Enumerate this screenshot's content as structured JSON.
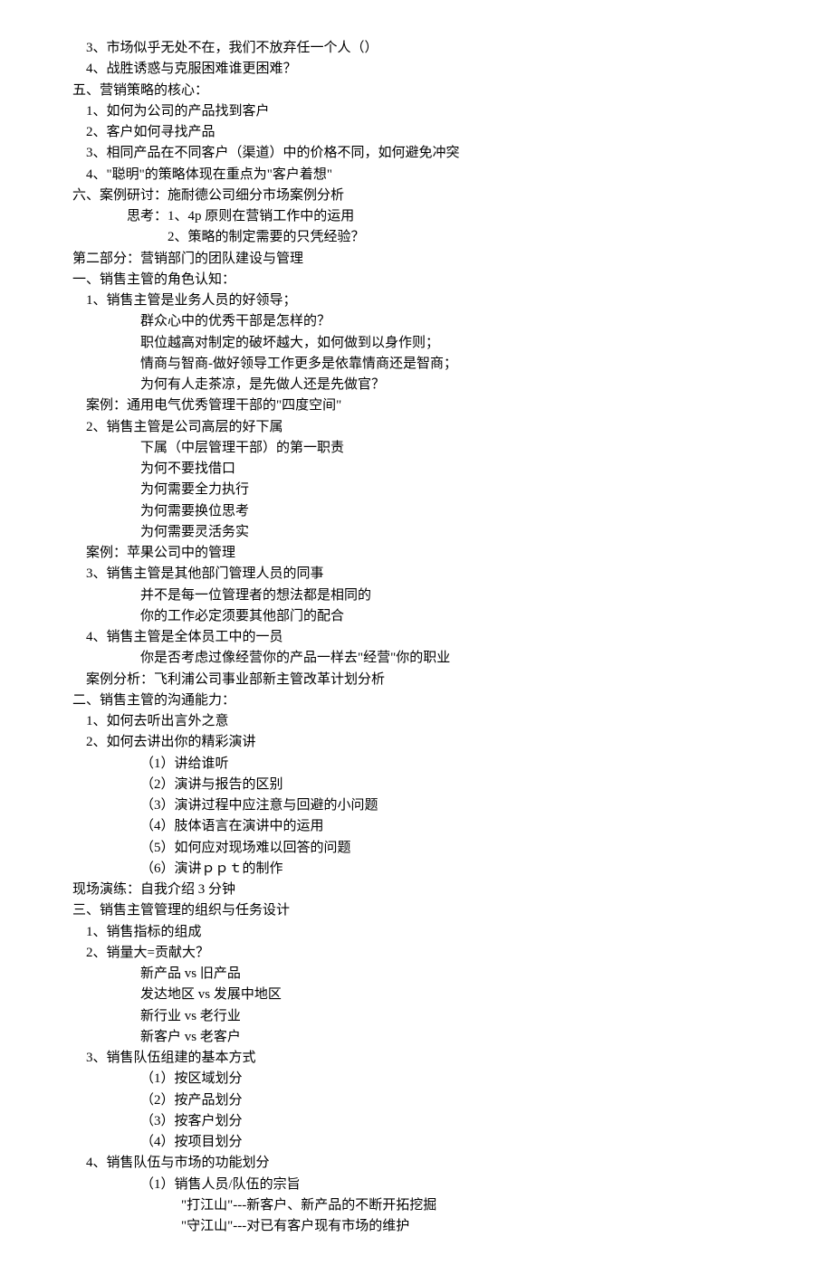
{
  "lines": [
    {
      "cls": "l1",
      "text": "3、市场似乎无处不在，我们不放弃任一个人（）"
    },
    {
      "cls": "l1",
      "text": "4、战胜诱惑与克服困难谁更困难？"
    },
    {
      "cls": "l0",
      "text": "五、营销策略的核心："
    },
    {
      "cls": "l1",
      "text": "1、如何为公司的产品找到客户"
    },
    {
      "cls": "l1",
      "text": "2、客户如何寻找产品"
    },
    {
      "cls": "l1",
      "text": "3、相同产品在不同客户（渠道）中的价格不同，如何避免冲突"
    },
    {
      "cls": "l1",
      "text": "4、\"聪明\"的策略体现在重点为\"客户着想\""
    },
    {
      "cls": "l0",
      "text": "六、案例研讨：施耐德公司细分市场案例分析"
    },
    {
      "cls": "l2",
      "text": "思考：1、4p 原则在营销工作中的运用"
    },
    {
      "cls": "l2",
      "text": "            2、策略的制定需要的只凭经验？"
    },
    {
      "cls": "l0",
      "text": "第二部分：营销部门的团队建设与管理"
    },
    {
      "cls": "l0",
      "text": "一、销售主管的角色认知："
    },
    {
      "cls": "l1",
      "text": "1、销售主管是业务人员的好领导；"
    },
    {
      "cls": "l3",
      "text": "群众心中的优秀干部是怎样的？"
    },
    {
      "cls": "l3",
      "text": "职位越高对制定的破坏越大，如何做到以身作则；"
    },
    {
      "cls": "l3",
      "text": "情商与智商-做好领导工作更多是依靠情商还是智商；"
    },
    {
      "cls": "l3",
      "text": "为何有人走茶凉，是先做人还是先做官？"
    },
    {
      "cls": "l1",
      "text": "案例：通用电气优秀管理干部的\"四度空间\""
    },
    {
      "cls": "l1",
      "text": "2、销售主管是公司高层的好下属"
    },
    {
      "cls": "l3",
      "text": "下属（中层管理干部）的第一职责"
    },
    {
      "cls": "l3",
      "text": "为何不要找借口"
    },
    {
      "cls": "l3",
      "text": "为何需要全力执行"
    },
    {
      "cls": "l3",
      "text": "为何需要换位思考"
    },
    {
      "cls": "l3",
      "text": "为何需要灵活务实"
    },
    {
      "cls": "l1",
      "text": "案例：苹果公司中的管理"
    },
    {
      "cls": "l1",
      "text": "3、销售主管是其他部门管理人员的同事"
    },
    {
      "cls": "l3",
      "text": "并不是每一位管理者的想法都是相同的"
    },
    {
      "cls": "l3",
      "text": "你的工作必定须要其他部门的配合"
    },
    {
      "cls": "l1",
      "text": "4、销售主管是全体员工中的一员"
    },
    {
      "cls": "l3",
      "text": "你是否考虑过像经营你的产品一样去\"经营\"你的职业"
    },
    {
      "cls": "l1",
      "text": "案例分析：飞利浦公司事业部新主管改革计划分析"
    },
    {
      "cls": "l0",
      "text": "二、销售主管的沟通能力："
    },
    {
      "cls": "l1",
      "text": "1、如何去听出言外之意"
    },
    {
      "cls": "l1",
      "text": "2、如何去讲出你的精彩演讲"
    },
    {
      "cls": "l3",
      "text": "（1）讲给谁听"
    },
    {
      "cls": "l3",
      "text": "（2）演讲与报告的区别"
    },
    {
      "cls": "l3",
      "text": "（3）演讲过程中应注意与回避的小问题"
    },
    {
      "cls": "l3",
      "text": "（4）肢体语言在演讲中的运用"
    },
    {
      "cls": "l3",
      "text": "（5）如何应对现场难以回答的问题"
    },
    {
      "cls": "l3",
      "text": "（6）演讲ｐｐｔ的制作"
    },
    {
      "cls": "l0",
      "text": "现场演练：自我介绍 3 分钟"
    },
    {
      "cls": "l0",
      "text": "三、销售主管管理的组织与任务设计"
    },
    {
      "cls": "l1",
      "text": "1、销售指标的组成"
    },
    {
      "cls": "l1",
      "text": "2、销量大=贡献大？"
    },
    {
      "cls": "l3",
      "text": "新产品 vs 旧产品"
    },
    {
      "cls": "l3",
      "text": "发达地区 vs 发展中地区"
    },
    {
      "cls": "l3",
      "text": "新行业 vs 老行业"
    },
    {
      "cls": "l3",
      "text": "新客户 vs 老客户"
    },
    {
      "cls": "l1",
      "text": "3、销售队伍组建的基本方式"
    },
    {
      "cls": "l3",
      "text": "（1）按区域划分"
    },
    {
      "cls": "l3",
      "text": "（2）按产品划分"
    },
    {
      "cls": "l3",
      "text": "（3）按客户划分"
    },
    {
      "cls": "l3",
      "text": "（4）按项目划分"
    },
    {
      "cls": "l1",
      "text": "4、销售队伍与市场的功能划分"
    },
    {
      "cls": "l3",
      "text": "（1）销售人员/队伍的宗旨"
    },
    {
      "cls": "l4",
      "text": "\"打江山\"---新客户、新产品的不断开拓挖掘"
    },
    {
      "cls": "l4",
      "text": "\"守江山\"---对已有客户现有市场的维护"
    }
  ]
}
